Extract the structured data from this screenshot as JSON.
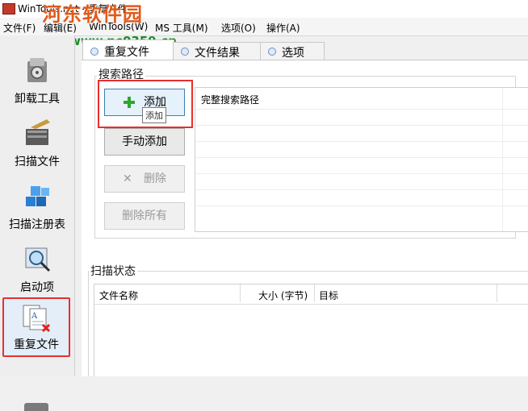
{
  "window": {
    "title": "WinTools.net - 重复文件"
  },
  "watermark": {
    "text": "河东软件园",
    "url": "www.pc0359.cn"
  },
  "menu": [
    {
      "label": "文件(F)"
    },
    {
      "label": "编辑(E)"
    },
    {
      "label": "WinTools(W)"
    },
    {
      "label": "MS 工具(M)"
    },
    {
      "label": "选项(O)"
    },
    {
      "label": "操作(A)"
    }
  ],
  "sidebar": {
    "items": [
      {
        "label": "卸载工具",
        "icon": "uninstall-icon"
      },
      {
        "label": "扫描文件",
        "icon": "scan-files-icon"
      },
      {
        "label": "扫描注册表",
        "icon": "registry-cubes-icon"
      },
      {
        "label": "启动项",
        "icon": "startup-magnifier-icon"
      },
      {
        "label": "重复文件",
        "icon": "duplicate-files-icon",
        "active": true
      }
    ]
  },
  "tabs": [
    {
      "label": "重复文件",
      "active": true
    },
    {
      "label": "文件结果"
    },
    {
      "label": "选项"
    }
  ],
  "search_paths": {
    "group_title": "搜索路径",
    "buttons": {
      "add": "添加",
      "manual_add": "手动添加",
      "delete": "删除",
      "delete_all": "删除所有"
    },
    "tooltip": "添加",
    "column_header": "完整搜索路径"
  },
  "scan_status": {
    "group_title": "扫描状态",
    "columns": [
      "文件名称",
      "大小 (字节)",
      "目标"
    ]
  },
  "colors": {
    "highlight": "#e53030",
    "add_icon": "#2fa52f"
  }
}
